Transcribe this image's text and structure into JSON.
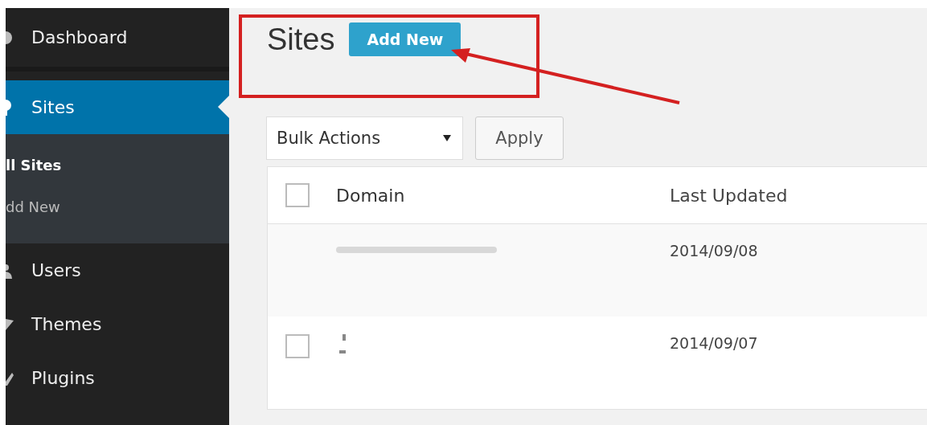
{
  "sidebar": {
    "items": [
      {
        "label": "Dashboard",
        "selected": false
      },
      {
        "label": "Sites",
        "selected": true,
        "children": [
          {
            "label": "ll Sites",
            "selected": true
          },
          {
            "label": "dd New",
            "selected": false
          }
        ]
      },
      {
        "label": "Users",
        "selected": false
      },
      {
        "label": "Themes",
        "selected": false
      },
      {
        "label": "Plugins",
        "selected": false
      }
    ]
  },
  "page": {
    "title": "Sites",
    "add_button": "Add New"
  },
  "bulk": {
    "value": "Bulk Actions",
    "apply": "Apply"
  },
  "table": {
    "select_all_checked": false,
    "columns": [
      "Domain",
      "Last Updated"
    ],
    "rows": [
      {
        "kind": "main",
        "updated": "2014/09/08"
      },
      {
        "kind": "site",
        "checked": false,
        "updated": "2014/09/07"
      }
    ]
  }
}
